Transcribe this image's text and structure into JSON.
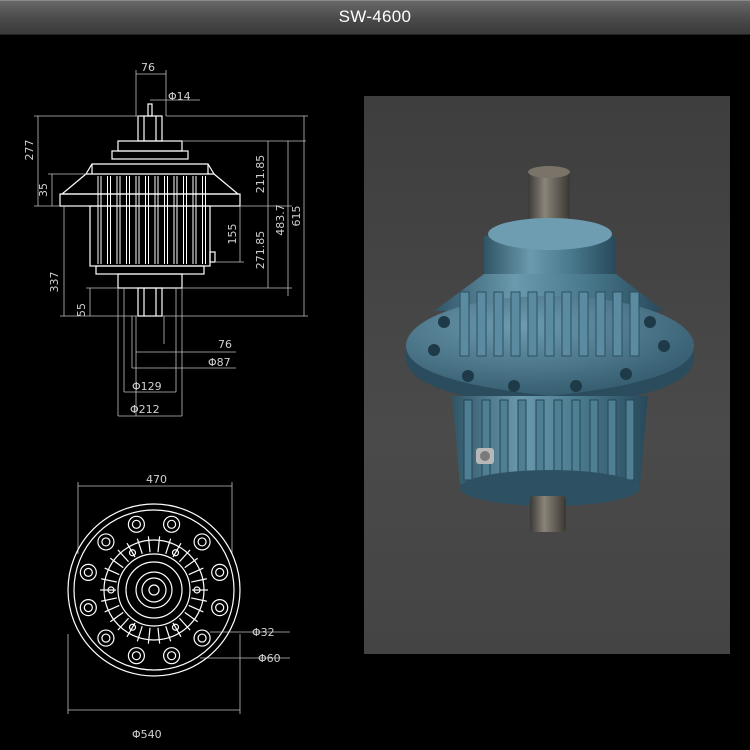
{
  "header": {
    "title": "SW-4600"
  },
  "side_view": {
    "dims": {
      "top_width": "76",
      "shaft_dia": "14",
      "h277": "277",
      "h35": "35",
      "h337": "337",
      "h55": "55",
      "h211": "211.85",
      "h155": "155",
      "h271": "271.85",
      "h483": "483.7",
      "h615": "615",
      "bottom_76": "76",
      "dia87": "87",
      "dia129": "129",
      "dia212": "212"
    }
  },
  "front_view": {
    "dims": {
      "width470": "470",
      "dia32": "32",
      "dia60": "60",
      "dia540": "540"
    }
  },
  "colors": {
    "line": "#ffffff",
    "dim_line": "#bfbfbf",
    "motor_body": "#3f6c80"
  },
  "symbols": {
    "diameter": "Φ"
  }
}
